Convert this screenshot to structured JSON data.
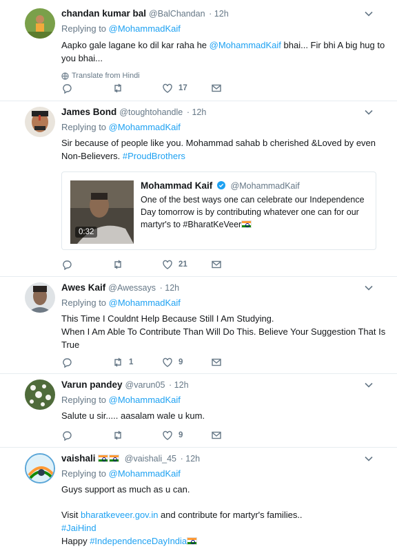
{
  "colors": {
    "link": "#1da1f2",
    "muted": "#657786",
    "divider": "#e6ecf0"
  },
  "tweets": [
    {
      "name": "chandan kumar bal",
      "handle": "@BalChandan",
      "time": "· 12h",
      "replying_prefix": "Replying to ",
      "replying_to": "@MohammadKaif",
      "text_pre": "Aapko gale lagane ko dil kar raha he ",
      "text_mention": "@MohammadKaif",
      "text_post": " bhai... Fir bhi A big hug to you bhai...",
      "translate": "Translate from Hindi",
      "retweets": "",
      "likes": "17"
    },
    {
      "name": "James Bond",
      "handle": "@toughtohandle",
      "time": "· 12h",
      "replying_prefix": "Replying to ",
      "replying_to": "@MohammadKaif",
      "text": "Sir because of people like you. Mohammad sahab b cherished &Loved by even Non-Believers. ",
      "hashtag": "#ProudBrothers",
      "quote": {
        "name": "Mohammad Kaif",
        "handle": "@MohammadKaif",
        "text": "One of the best ways one can celebrate our Independence Day tomorrow is by contributing whatever one can for our martyr's to #BharatKeVeer",
        "duration": "0:32"
      },
      "retweets": "",
      "likes": "21"
    },
    {
      "name": "Awes Kaif",
      "handle": "@Awessays",
      "time": "· 12h",
      "replying_prefix": "Replying to ",
      "replying_to": "@MohammadKaif",
      "line1": "This Time I Couldnt Help Because Still I Am Studying.",
      "line2": "When I Am Able To Contribute Than Will Do This. Believe Your Suggestion That Is True",
      "retweets": "1",
      "likes": "9"
    },
    {
      "name": "Varun pandey",
      "handle": "@varun05",
      "time": "· 12h",
      "replying_prefix": "Replying to ",
      "replying_to": "@MohammadKaif",
      "text": "Salute u sir..... aasalam wale u kum.",
      "retweets": "",
      "likes": "9"
    },
    {
      "name": "vaishali",
      "handle": "@vaishali_45",
      "time": "· 12h",
      "replying_prefix": "Replying to ",
      "replying_to": "@MohammadKaif",
      "line1": "Guys support as much as u can.",
      "visit_pre": "Visit ",
      "visit_link": "bharatkeveer.gov.in",
      "visit_post": " and contribute for martyr's families..",
      "hashtag1": "#JaiHind",
      "happy_pre": "Happy ",
      "hashtag2": "#IndependenceDayIndia"
    }
  ]
}
